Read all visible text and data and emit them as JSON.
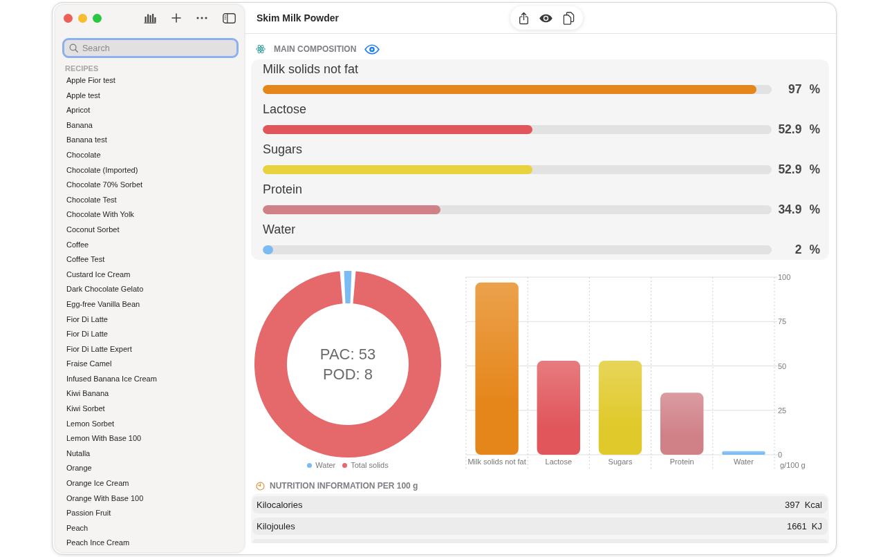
{
  "window": {
    "title": "Skim Milk Powder"
  },
  "sidebar": {
    "search": {
      "placeholder": "Search",
      "focused": true
    },
    "section_title": "RECIPES",
    "items": [
      {
        "label": "Apple Fior test",
        "selected": false
      },
      {
        "label": "Apple test",
        "selected": false
      },
      {
        "label": "Apricot",
        "selected": false
      },
      {
        "label": "Banana",
        "selected": false
      },
      {
        "label": "Banana test",
        "selected": false
      },
      {
        "label": "Chocolate",
        "selected": false
      },
      {
        "label": "Chocolate (Imported)",
        "selected": false
      },
      {
        "label": "Chocolate 70% Sorbet",
        "selected": false
      },
      {
        "label": "Chocolate Test",
        "selected": false
      },
      {
        "label": "Chocolate With Yolk",
        "selected": false
      },
      {
        "label": "Coconut Sorbet",
        "selected": false
      },
      {
        "label": "Coffee",
        "selected": false
      },
      {
        "label": "Coffee Test",
        "selected": false
      },
      {
        "label": "Custard Ice Cream",
        "selected": false
      },
      {
        "label": "Dark Chocolate Gelato",
        "selected": false
      },
      {
        "label": "Egg-free Vanilla Bean",
        "selected": false
      },
      {
        "label": "Fior Di Latte",
        "selected": false
      },
      {
        "label": "Fior Di Latte",
        "selected": false
      },
      {
        "label": "Fior Di Latte Expert",
        "selected": false
      },
      {
        "label": "Fraise Camel",
        "selected": false
      },
      {
        "label": "Infused Banana Ice Cream",
        "selected": false
      },
      {
        "label": "Kiwi Banana",
        "selected": false
      },
      {
        "label": "Kiwi Sorbet",
        "selected": false
      },
      {
        "label": "Lemon Sorbet",
        "selected": false
      },
      {
        "label": "Lemon With Base 100",
        "selected": false
      },
      {
        "label": "Nutalla",
        "selected": false
      },
      {
        "label": "Orange",
        "selected": false
      },
      {
        "label": "Orange Ice Cream",
        "selected": false
      },
      {
        "label": "Orange With Base 100",
        "selected": false
      },
      {
        "label": "Passion Fruit",
        "selected": false
      },
      {
        "label": "Peach",
        "selected": false
      },
      {
        "label": "Peach Ince Cream",
        "selected": false
      }
    ]
  },
  "composition": {
    "title": "MAIN COMPOSITION",
    "rows": [
      {
        "label": "Milk solids not fat",
        "level": 0.97,
        "value": "97",
        "unit": "%",
        "color": "#e5861a"
      },
      {
        "label": "Lactose",
        "level": 0.529,
        "value": "52.9",
        "unit": "%",
        "color": "#e0565b"
      },
      {
        "label": "Sugars",
        "level": 0.529,
        "value": "52.9",
        "unit": "%",
        "color": "#e8d23d"
      },
      {
        "label": "Protein",
        "level": 0.349,
        "value": "34.9",
        "unit": "%",
        "color": "#d08087"
      },
      {
        "label": "Water",
        "level": 0.02,
        "value": "2",
        "unit": "%",
        "color": "#7bbbf3"
      }
    ]
  },
  "solids_chart": {
    "center_lines": [
      "PAC: 53",
      "POD: 8"
    ],
    "chart_data": {
      "type": "donut",
      "categories": [
        "Water",
        "Total solids"
      ],
      "values": [
        2,
        98
      ],
      "colors": [
        "#7bbbf3",
        "#e5686b"
      ],
      "legend": "bottom"
    }
  },
  "composition_chart": {
    "chart_data": {
      "type": "bar",
      "categories": [
        "Milk solids not fat",
        "Lactose",
        "Sugars",
        "Protein",
        "Water"
      ],
      "values": [
        97,
        52.9,
        52.9,
        34.9,
        2
      ],
      "colors": [
        "#e5861a",
        "#e0565b",
        "#e0c92a",
        "#d08087",
        "#7bbbf3"
      ],
      "ylabel": "g/100 g",
      "ylim": [
        0,
        100
      ],
      "yticks": [
        0,
        25,
        50,
        75,
        100
      ],
      "grid": true
    }
  },
  "nutrition": {
    "title": "NUTRITION INFORMATION PER 100 g",
    "rows": [
      {
        "label": "Kilocalories",
        "value": "397",
        "unit": "Kcal"
      },
      {
        "label": "Kilojoules",
        "value": "1661",
        "unit": "KJ"
      }
    ]
  }
}
